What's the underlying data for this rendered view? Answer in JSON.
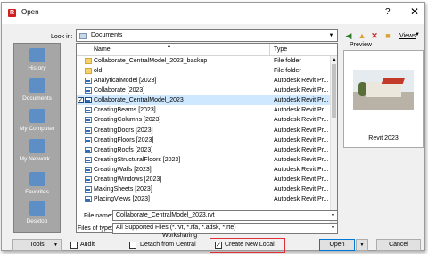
{
  "window": {
    "title": "Open",
    "help_glyph": "?",
    "close_glyph": "✕"
  },
  "lookin": {
    "label": "Look in:",
    "value": "Documents"
  },
  "toolbar": {
    "views_label": "Views"
  },
  "places": [
    {
      "label": "History"
    },
    {
      "label": "Documents"
    },
    {
      "label": "My Computer"
    },
    {
      "label": "My Network..."
    },
    {
      "label": "Favorites"
    },
    {
      "label": "Desktop"
    }
  ],
  "list": {
    "col_name": "Name",
    "col_type": "Type",
    "rows": [
      {
        "name": "Collaborate_CentralModel_2023_backup",
        "type": "File folder",
        "kind": "folder"
      },
      {
        "name": "old",
        "type": "File folder",
        "kind": "folder"
      },
      {
        "name": "AnalyticalModel [2023]",
        "type": "Autodesk Revit Pr...",
        "kind": "file"
      },
      {
        "name": "Collaborate [2023]",
        "type": "Autodesk Revit Pr...",
        "kind": "file"
      },
      {
        "name": "Collaborate_CentralModel_2023",
        "type": "Autodesk Revit Pr...",
        "kind": "file",
        "selected": true
      },
      {
        "name": "CreatingBeams [2023]",
        "type": "Autodesk Revit Pr...",
        "kind": "file"
      },
      {
        "name": "CreatingColumns [2023]",
        "type": "Autodesk Revit Pr...",
        "kind": "file"
      },
      {
        "name": "CreatingDoors [2023]",
        "type": "Autodesk Revit Pr...",
        "kind": "file"
      },
      {
        "name": "CreatingFloors [2023]",
        "type": "Autodesk Revit Pr...",
        "kind": "file"
      },
      {
        "name": "CreatingRoofs [2023]",
        "type": "Autodesk Revit Pr...",
        "kind": "file"
      },
      {
        "name": "CreatingStructuralFloors [2023]",
        "type": "Autodesk Revit Pr...",
        "kind": "file"
      },
      {
        "name": "CreatingWalls [2023]",
        "type": "Autodesk Revit Pr...",
        "kind": "file"
      },
      {
        "name": "CreatingWindows [2023]",
        "type": "Autodesk Revit Pr...",
        "kind": "file"
      },
      {
        "name": "MakingSheets [2023]",
        "type": "Autodesk Revit Pr...",
        "kind": "file"
      },
      {
        "name": "PlacingViews [2023]",
        "type": "Autodesk Revit Pr...",
        "kind": "file"
      }
    ]
  },
  "preview": {
    "label": "Preview",
    "caption": "Revit 2023"
  },
  "filename": {
    "label": "File name:",
    "value": "Collaborate_CentralModel_2023.rvt"
  },
  "filetype": {
    "label": "Files of type:",
    "value": "All Supported Files  (*.rvt, *.rfa, *.adsk, *.rte)"
  },
  "worksharing": {
    "label": "Worksharing",
    "detach_label": "Detach from Central",
    "create_local_label": "Create New Local",
    "create_local_checked": true
  },
  "audit": {
    "label": "Audit"
  },
  "buttons": {
    "tools": "Tools",
    "open": "Open",
    "cancel": "Cancel"
  },
  "colors": {
    "selection": "#cde8ff",
    "highlight_box": "#e0303a",
    "accent": "#0078d7"
  }
}
